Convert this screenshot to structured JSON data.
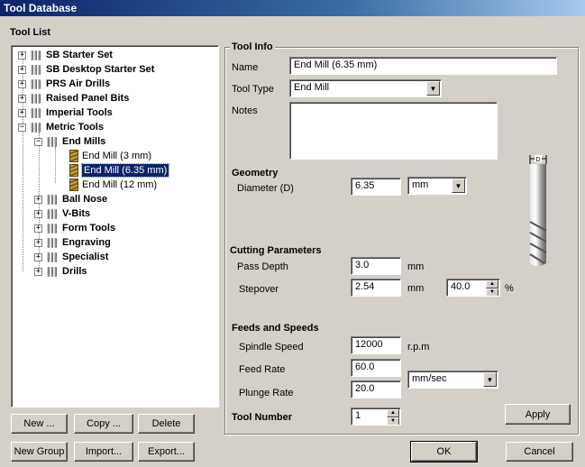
{
  "window": {
    "title": "Tool Database"
  },
  "tool_list": {
    "heading": "Tool List",
    "items": [
      {
        "label": "SB Starter Set",
        "expander": "+"
      },
      {
        "label": "SB Desktop Starter Set",
        "expander": "+"
      },
      {
        "label": "PRS Air Drills",
        "expander": "+"
      },
      {
        "label": "Raised Panel Bits",
        "expander": "+"
      },
      {
        "label": "Imperial Tools",
        "expander": "+"
      },
      {
        "label": "Metric Tools",
        "expander": "−"
      },
      {
        "label": "End Mills",
        "expander": "−"
      },
      {
        "label": "End Mill (3 mm)"
      },
      {
        "label": "End Mill (6.35 mm)"
      },
      {
        "label": "End Mill (12 mm)"
      },
      {
        "label": "Ball Nose",
        "expander": "+"
      },
      {
        "label": "V-Bits",
        "expander": "+"
      },
      {
        "label": "Form Tools",
        "expander": "+"
      },
      {
        "label": "Engraving",
        "expander": "+"
      },
      {
        "label": "Specialist",
        "expander": "+"
      },
      {
        "label": "Drills",
        "expander": "+"
      }
    ],
    "buttons": {
      "new": "New ...",
      "copy": "Copy ...",
      "delete": "Delete",
      "new_group": "New Group",
      "import": "Import...",
      "export": "Export..."
    }
  },
  "tool_info": {
    "heading": "Tool Info",
    "name_label": "Name",
    "name_value": "End Mill (6.35 mm)",
    "type_label": "Tool Type",
    "type_value": "End Mill",
    "notes_label": "Notes",
    "notes_value": ""
  },
  "geometry": {
    "heading": "Geometry",
    "diameter_label": "Diameter (D)",
    "diameter_value": "6.35",
    "diameter_unit": "mm",
    "diagram_label": "D"
  },
  "cutting": {
    "heading": "Cutting Parameters",
    "pass_depth_label": "Pass Depth",
    "pass_depth_value": "3.0",
    "pass_depth_unit": "mm",
    "stepover_label": "Stepover",
    "stepover_value": "2.54",
    "stepover_unit": "mm",
    "stepover_pct_value": "40.0",
    "stepover_pct_unit": "%"
  },
  "feeds": {
    "heading": "Feeds and Speeds",
    "spindle_label": "Spindle Speed",
    "spindle_value": "12000",
    "spindle_unit": "r.p.m",
    "feed_label": "Feed Rate",
    "feed_value": "60.0",
    "plunge_label": "Plunge Rate",
    "plunge_value": "20.0",
    "rate_unit": "mm/sec"
  },
  "tool_number": {
    "label": "Tool Number",
    "value": "1"
  },
  "actions": {
    "apply": "Apply",
    "ok": "OK",
    "cancel": "Cancel"
  },
  "colors": {
    "title_bar": "#0a246a",
    "selection": "#0a246a",
    "face": "#d4d0c8"
  }
}
